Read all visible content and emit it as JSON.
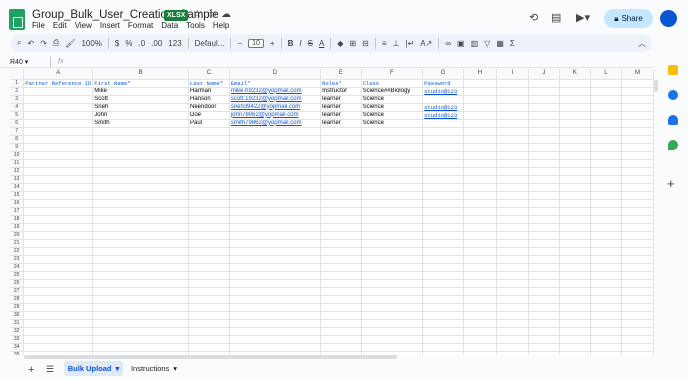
{
  "title": "Group_Bulk_User_Creation_Sample",
  "badge": "XLSX",
  "menu": [
    "File",
    "Edit",
    "View",
    "Insert",
    "Format",
    "Data",
    "Tools",
    "Help"
  ],
  "share_label": "Share",
  "toolbar": {
    "zoom": "100%",
    "currency": "$",
    "percent": "%",
    "decimals": "123",
    "font": "Defaul...",
    "font_size": "10"
  },
  "namebox": "R40",
  "fx": "fx",
  "columns": [
    "A",
    "B",
    "C",
    "D",
    "E",
    "F",
    "G",
    "H",
    "I",
    "J",
    "K",
    "L",
    "M"
  ],
  "header_row": [
    "Partner Reference ID",
    "First Name*",
    "Last Name*",
    "Email*",
    "Roles*",
    "Class",
    "Password",
    "",
    "",
    "",
    "",
    "",
    ""
  ],
  "rows": [
    [
      "",
      "Mike",
      "Harman",
      "mike.h9232@yopmail.com",
      "Instructor",
      "Science##Biology",
      "studio@123"
    ],
    [
      "",
      "Scott",
      "Hanson",
      "scott.19232@yopmail.com",
      "learner",
      "Science",
      ""
    ],
    [
      "",
      "Sneh",
      "Neendoor",
      "sneh39422@yopmail.com",
      "learner",
      "Science",
      "studio@123"
    ],
    [
      "",
      "John",
      "Doe",
      "john78062@yopmail.com",
      "learner",
      "Science",
      "studio@123"
    ],
    [
      "",
      "Smith",
      "Paul",
      "smith79862@yopmail.com",
      "learner",
      "Science",
      ""
    ]
  ],
  "row_count": 36,
  "sheets": [
    "Bulk Upload",
    "Instructions"
  ],
  "colors": {
    "accent": "#0b57d0",
    "share_bg": "#c2e7ff",
    "sheets_green": "#1ea362"
  }
}
